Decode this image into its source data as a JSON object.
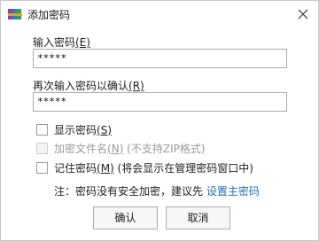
{
  "window": {
    "title": "添加密码",
    "icon": "winrar-books-icon",
    "close_glyph": "✕"
  },
  "fields": {
    "password_label": "输入密码",
    "password_mnemonic": "(E)",
    "password_value": "*****",
    "confirm_label": "再次输入密码以确认",
    "confirm_mnemonic": "(R)",
    "confirm_value": "*****"
  },
  "options": {
    "show_password": {
      "label": "显示密码",
      "mnemonic": "(S)",
      "checked": false,
      "enabled": true
    },
    "encrypt_filenames": {
      "label": "加密文件名",
      "mnemonic": "(N)",
      "suffix": " (不支持ZIP格式)",
      "checked": false,
      "enabled": false
    },
    "remember_password": {
      "label": "记住密码",
      "mnemonic": "(M)",
      "suffix": " (将会显示在管理密码窗口中)",
      "checked": false,
      "enabled": true
    }
  },
  "note": {
    "text": "注：密码没有安全加密，建议先 ",
    "link": "设置主密码"
  },
  "buttons": {
    "ok": "确认",
    "cancel": "取消"
  },
  "colors": {
    "link": "#1e6fc8",
    "disabled_text": "#9a9a9a"
  }
}
